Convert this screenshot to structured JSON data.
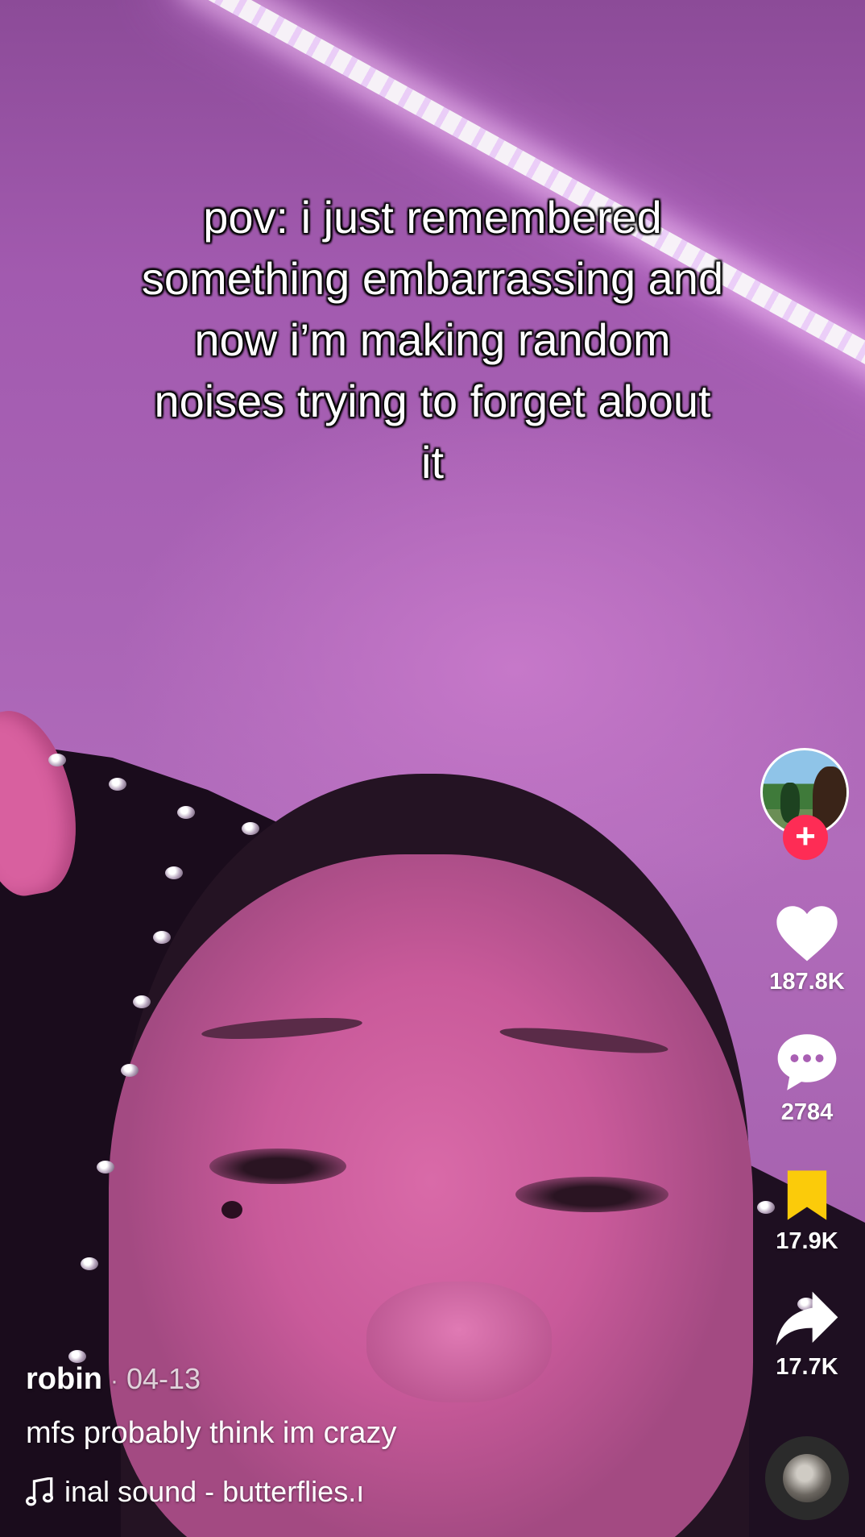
{
  "caption": "pov: i just remembered\nsomething embarrassing and\nnow i’m making random\nnoises trying to forget about\nit",
  "rail": {
    "follow_symbol": "+",
    "likes": "187.8K",
    "comments": "2784",
    "saves": "17.9K",
    "shares": "17.7K",
    "like_icon_color": "#ffffff",
    "save_icon_color": "#fbcb0a",
    "follow_color": "#fe2c55"
  },
  "post": {
    "username": "robin",
    "separator": "·",
    "date": "04-13",
    "description": "mfs probably think im crazy",
    "sound": "inal sound - butterflies.ı"
  },
  "icons": {
    "like": "heart-icon",
    "comment": "comment-bubble-icon",
    "save": "bookmark-icon",
    "share": "share-arrow-icon",
    "music": "music-note-icon"
  }
}
